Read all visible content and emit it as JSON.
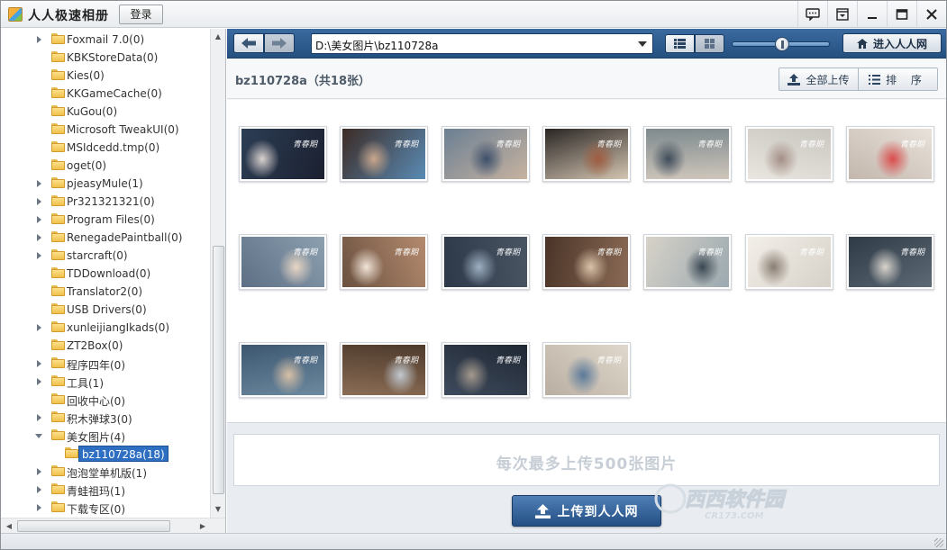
{
  "app": {
    "title": "人人极速相册",
    "login_label": "登录"
  },
  "window_controls": [
    {
      "name": "feedback-icon"
    },
    {
      "name": "menu-icon"
    },
    {
      "name": "minimize-icon"
    },
    {
      "name": "maximize-icon"
    },
    {
      "name": "close-icon"
    }
  ],
  "tree": {
    "items": [
      {
        "label": "Foxmail 7.0(0)",
        "expandable": true
      },
      {
        "label": "KBKStoreData(0)",
        "expandable": false
      },
      {
        "label": "Kies(0)",
        "expandable": false
      },
      {
        "label": "KKGameCache(0)",
        "expandable": false
      },
      {
        "label": "KuGou(0)",
        "expandable": false
      },
      {
        "label": "Microsoft TweakUI(0)",
        "expandable": false
      },
      {
        "label": "MSIdcedd.tmp(0)",
        "expandable": false
      },
      {
        "label": "oget(0)",
        "expandable": false
      },
      {
        "label": "pjeasyMule(1)",
        "expandable": true
      },
      {
        "label": "Pr321321321(0)",
        "expandable": true
      },
      {
        "label": "Program Files(0)",
        "expandable": true
      },
      {
        "label": "RenegadePaintball(0)",
        "expandable": true
      },
      {
        "label": "starcraft(0)",
        "expandable": true
      },
      {
        "label": "TDDownload(0)",
        "expandable": false
      },
      {
        "label": "Translator2(0)",
        "expandable": false
      },
      {
        "label": "USB Drivers(0)",
        "expandable": false
      },
      {
        "label": "xunleijiangIkads(0)",
        "expandable": true
      },
      {
        "label": "ZT2Box(0)",
        "expandable": false
      },
      {
        "label": "程序四年(0)",
        "expandable": true
      },
      {
        "label": "工具(1)",
        "expandable": true
      },
      {
        "label": "回收中心(0)",
        "expandable": false
      },
      {
        "label": "积木弹球3(0)",
        "expandable": true
      },
      {
        "label": "美女图片(4)",
        "expandable": true,
        "open": true
      },
      {
        "label": "bz110728a(18)",
        "expandable": false,
        "selected": true
      },
      {
        "label": "泡泡堂单机版(1)",
        "expandable": true
      },
      {
        "label": "青蛙祖玛(1)",
        "expandable": true
      },
      {
        "label": "下载专区(0)",
        "expandable": true
      }
    ]
  },
  "toolbar": {
    "path": "D:\\美女图片\\bz110728a",
    "zoom_level": 0.5,
    "enter_label": "进入人人网"
  },
  "album": {
    "title": "bz110728a（共18张）",
    "upload_all_label": "全部上传",
    "sort_label": "排 序"
  },
  "photos": {
    "watermark": "青春期",
    "items": [
      {
        "colors": [
          "#2c3e55",
          "#d9d2cf",
          "#1b2030"
        ]
      },
      {
        "colors": [
          "#3c2b25",
          "#c9a78c",
          "#5a8bb5"
        ]
      },
      {
        "colors": [
          "#6b7f93",
          "#3d4f6a",
          "#c7b3a0"
        ]
      },
      {
        "colors": [
          "#2a2624",
          "#a05c3e",
          "#d4c5b2"
        ]
      },
      {
        "colors": [
          "#7e8a8e",
          "#3f4c5a",
          "#cfc6bb"
        ]
      },
      {
        "colors": [
          "#c9c6c0",
          "#a48f86",
          "#e9e6e0"
        ]
      },
      {
        "colors": [
          "#e8e2da",
          "#d94c4c",
          "#c3b7ad"
        ]
      },
      {
        "colors": [
          "#8ca0b0",
          "#e9d6c4",
          "#5e6f85"
        ]
      },
      {
        "colors": [
          "#b48a6e",
          "#f1e4d8",
          "#6a5140"
        ]
      },
      {
        "colors": [
          "#4a5564",
          "#9db0c2",
          "#2d3848"
        ]
      },
      {
        "colors": [
          "#8a6a55",
          "#d9c2a8",
          "#4a3428"
        ]
      },
      {
        "colors": [
          "#9ba9b0",
          "#3a4752",
          "#d7d2c8"
        ]
      },
      {
        "colors": [
          "#d6d1c8",
          "#8a7e72",
          "#f3efe9"
        ]
      },
      {
        "colors": [
          "#5d6a76",
          "#d9d4cc",
          "#2e3a46"
        ]
      },
      {
        "colors": [
          "#6d8aa0",
          "#d7c0a6",
          "#3c5670"
        ]
      },
      {
        "colors": [
          "#8b6d55",
          "#c2c9d0",
          "#4d3a2c"
        ]
      },
      {
        "colors": [
          "#3e4b5d",
          "#a59a8e",
          "#1f2733"
        ]
      },
      {
        "colors": [
          "#b9aea2",
          "#5a7a9a",
          "#e0d8cc"
        ]
      }
    ]
  },
  "upload": {
    "drop_text": "每次最多上传500张图片",
    "button_label": "上传到人人网"
  },
  "watermark_site": {
    "name": "西西软件园",
    "url": "CR173.COM"
  },
  "colors": {
    "toolbar_top": "#3b6aa0",
    "toolbar_bottom": "#24507f",
    "selection": "#2f6fc2",
    "upload_button": "#244f84"
  }
}
